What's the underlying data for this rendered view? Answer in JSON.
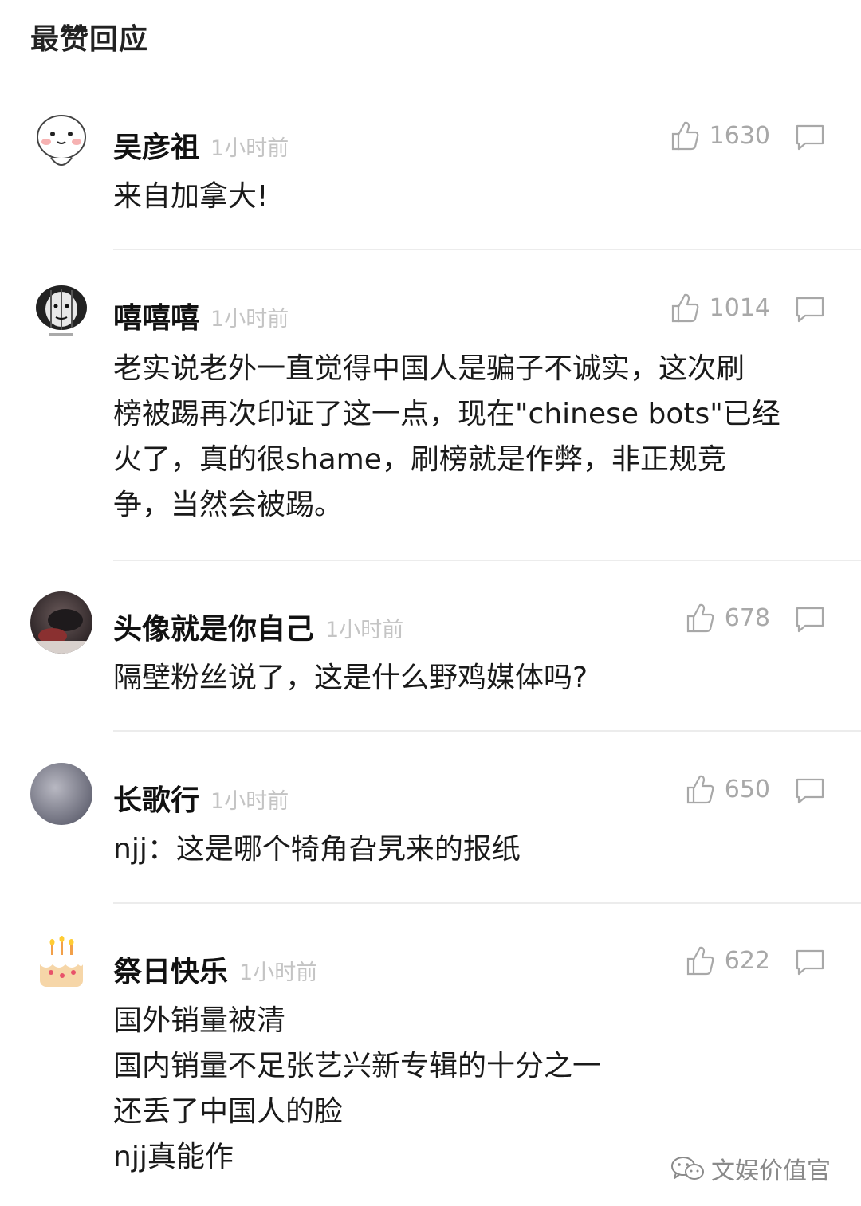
{
  "header": {
    "title": "最赞回应"
  },
  "comments": [
    {
      "username": "吴彦祖",
      "time": "1小时前",
      "likes": "1630",
      "content": "来自加拿大!",
      "avatar_icon": "cartoon-face-avatar"
    },
    {
      "username": "嘻嘻嘻",
      "time": "1小时前",
      "likes": "1014",
      "content": "老实说老外一直觉得中国人是骗子不诚实，这次刷\n榜被踢再次印证了这一点，现在\"chinese bots\"已经\n火了，真的很shame，刷榜就是作弊，非正规竞\n争，当然会被踢。",
      "avatar_icon": "meme-face-avatar"
    },
    {
      "username": "头像就是你自己",
      "time": "1小时前",
      "likes": "678",
      "content": "隔壁粉丝说了，这是什么野鸡媒体吗?",
      "avatar_icon": "photo-avatar"
    },
    {
      "username": "长歌行",
      "time": "1小时前",
      "likes": "650",
      "content": "njj：这是哪个犄角旮旯来的报纸",
      "avatar_icon": "gray-sky-avatar"
    },
    {
      "username": "祭日快乐",
      "time": "1小时前",
      "likes": "622",
      "content": "国外销量被清\n国内销量不足张艺兴新专辑的十分之一\n还丢了中国人的脸\nnjj真能作",
      "avatar_icon": "birthday-cake-avatar"
    }
  ],
  "watermark": {
    "text": "文娱价值官",
    "icon": "wechat-icon"
  },
  "colors": {
    "time": "#c4c4c4",
    "likes": "#a8a8a8",
    "divider": "#ececec"
  }
}
